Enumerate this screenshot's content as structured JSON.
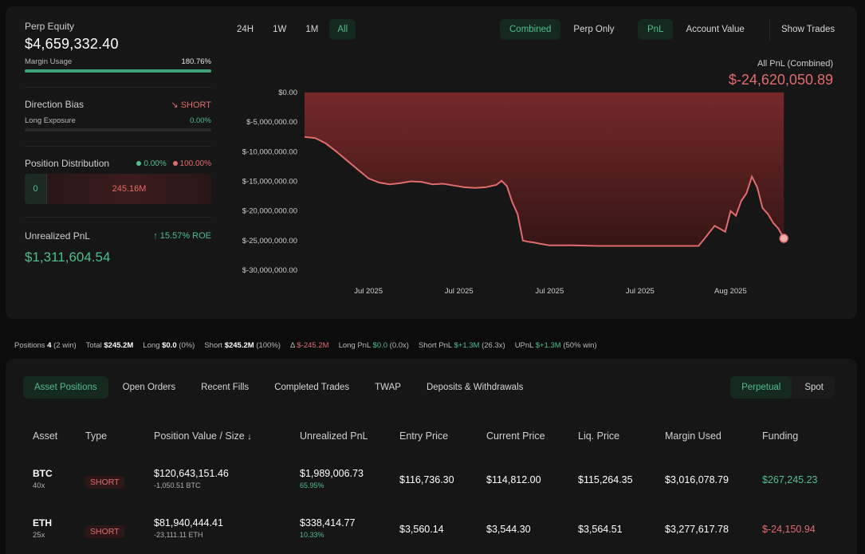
{
  "perp_equity": {
    "label": "Perp Equity",
    "value": "$4,659,332.40"
  },
  "margin_usage": {
    "label": "Margin Usage",
    "value": "180.76%",
    "level": 1.0
  },
  "direction_bias": {
    "label": "Direction Bias",
    "value": "SHORT",
    "arrow": "↘"
  },
  "long_exposure": {
    "label": "Long Exposure",
    "value": "0.00%",
    "level": 0.0
  },
  "position_distribution": {
    "label": "Position Distribution",
    "long_pct": "0.00%",
    "short_pct": "100.00%",
    "long_value": "0",
    "short_value": "245.16M"
  },
  "unrealized_pnl": {
    "label": "Unrealized PnL",
    "roe": "15.57% ROE",
    "roe_arrow": "↑",
    "value": "$1,311,604.54"
  },
  "timeframes": [
    {
      "label": "24H",
      "active": false
    },
    {
      "label": "1W",
      "active": false
    },
    {
      "label": "1M",
      "active": false
    },
    {
      "label": "All",
      "active": true
    }
  ],
  "modes": [
    {
      "label": "Combined",
      "active": true
    },
    {
      "label": "Perp Only",
      "active": false
    }
  ],
  "metrics": [
    {
      "label": "PnL",
      "active": true
    },
    {
      "label": "Account Value",
      "active": false
    }
  ],
  "show_trades": "Show Trades",
  "chart_header": {
    "label": "All PnL (Combined)",
    "value": "$-24,620,050.89"
  },
  "chart_data": {
    "type": "area",
    "title": "",
    "ylim": [
      -30000000,
      0
    ],
    "yticks": [
      "$0.00",
      "$-5,000,000.00",
      "$-10,000,000.00",
      "$-15,000,000.00",
      "$-20,000,000.00",
      "$-25,000,000.00",
      "$-30,000,000.00"
    ],
    "ytick_values": [
      0,
      -5000000,
      -10000000,
      -15000000,
      -20000000,
      -25000000,
      -30000000
    ],
    "xticks": [
      "Jul 2025",
      "Jul 2025",
      "Jul 2025",
      "Jul 2025",
      "Aug 2025"
    ],
    "xtick_positions": [
      0.12,
      0.29,
      0.46,
      0.63,
      0.8
    ],
    "x": [
      0,
      0.02,
      0.04,
      0.06,
      0.08,
      0.1,
      0.12,
      0.14,
      0.16,
      0.18,
      0.2,
      0.22,
      0.24,
      0.26,
      0.28,
      0.3,
      0.32,
      0.34,
      0.36,
      0.37,
      0.38,
      0.39,
      0.4,
      0.41,
      0.42,
      0.43,
      0.44,
      0.46,
      0.5,
      0.55,
      0.6,
      0.65,
      0.7,
      0.74,
      0.75,
      0.77,
      0.79,
      0.8,
      0.81,
      0.82,
      0.83,
      0.84,
      0.85,
      0.86,
      0.87,
      0.88,
      0.89,
      0.9,
      0.91,
      0.92,
      0.93,
      0.94,
      0.95,
      0.96,
      0.97
    ],
    "y": [
      -7500000,
      -7700000,
      -8600000,
      -10000000,
      -11500000,
      -13000000,
      -14500000,
      -15200000,
      -15500000,
      -15300000,
      -15000000,
      -15100000,
      -15500000,
      -15400000,
      -15700000,
      -16000000,
      -16100000,
      -16000000,
      -15600000,
      -14900000,
      -15800000,
      -18500000,
      -20500000,
      -25000000,
      -25200000,
      -25300000,
      -25500000,
      -25800000,
      -25800000,
      -25900000,
      -25900000,
      -25900000,
      -25900000,
      -25900000,
      -24800000,
      -22500000,
      -23500000,
      -20000000,
      -20800000,
      -18300000,
      -17000000,
      -14200000,
      -16000000,
      -19500000,
      -20500000,
      -22000000,
      -23000000,
      -24620050
    ],
    "series": [
      {
        "values": []
      }
    ],
    "grid": false
  },
  "summary": {
    "positions_label": "Positions",
    "positions_count": "4",
    "positions_win": "(2 win)",
    "total_label": "Total",
    "total_value": "$245.2M",
    "long_label": "Long",
    "long_value": "$0.0",
    "long_pct": "(0%)",
    "short_label": "Short",
    "short_value": "$245.2M",
    "short_pct": "(100%)",
    "delta_label": "Δ",
    "delta_value": "$-245.2M",
    "long_pnl_label": "Long PnL",
    "long_pnl_value": "$0.0",
    "long_pnl_x": "(0.0x)",
    "short_pnl_label": "Short PnL",
    "short_pnl_value": "$+1.3M",
    "short_pnl_x": "(26.3x)",
    "upnl_label": "UPnL",
    "upnl_value": "$+1.3M",
    "upnl_win": "(50% win)"
  },
  "position_tabs": [
    {
      "label": "Asset Positions",
      "active": true
    },
    {
      "label": "Open Orders",
      "active": false
    },
    {
      "label": "Recent Fills",
      "active": false
    },
    {
      "label": "Completed Trades",
      "active": false
    },
    {
      "label": "TWAP",
      "active": false
    },
    {
      "label": "Deposits & Withdrawals",
      "active": false
    }
  ],
  "market_tabs": [
    {
      "label": "Perpetual",
      "active": true
    },
    {
      "label": "Spot",
      "active": false
    }
  ],
  "table": {
    "headers": [
      "Asset",
      "Type",
      "Position Value / Size",
      "Unrealized PnL",
      "Entry Price",
      "Current Price",
      "Liq. Price",
      "Margin Used",
      "Funding"
    ],
    "sort_arrow": "↓",
    "rows": [
      {
        "asset": "BTC",
        "leverage": "40x",
        "type": "SHORT",
        "value": "$120,643,151.46",
        "size": "-1,050.51 BTC",
        "upnl": "$1,989,006.73",
        "upnl_pct": "65.95%",
        "entry": "$116,736.30",
        "current": "$114,812.00",
        "liq": "$115,264.35",
        "margin": "$3,016,078.79",
        "funding": "$267,245.23",
        "funding_color": "#4fbf8c"
      },
      {
        "asset": "ETH",
        "leverage": "25x",
        "type": "SHORT",
        "value": "$81,940,444.41",
        "size": "-23,111.11 ETH",
        "upnl": "$338,414.77",
        "upnl_pct": "10.33%",
        "entry": "$3,560.14",
        "current": "$3,544.30",
        "liq": "$3,564.51",
        "margin": "$3,277,617.78",
        "funding": "$-24,150.94",
        "funding_color": "#e06c6c"
      }
    ]
  },
  "colors": {
    "accent_green": "#4fbf8c",
    "accent_red": "#e06c6c",
    "background": "#0c0c0c",
    "card": "#161616"
  }
}
